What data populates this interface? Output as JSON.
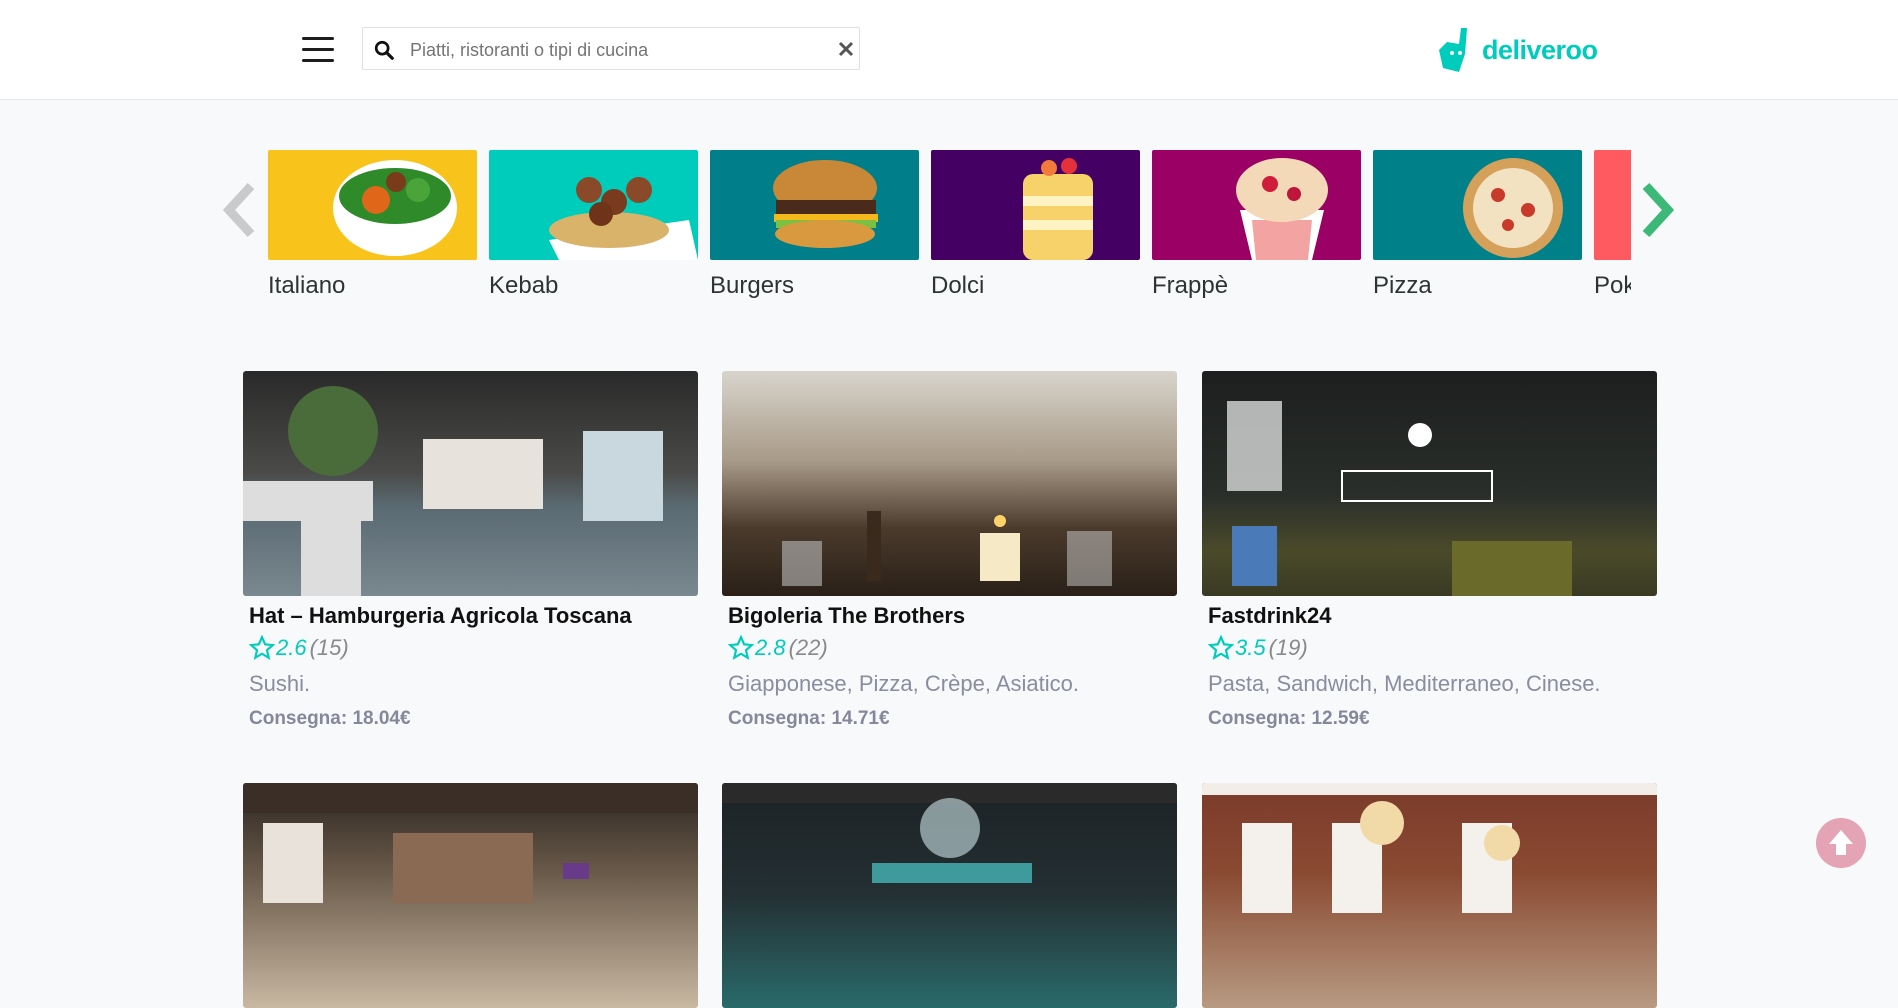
{
  "search": {
    "placeholder": "Piatti, ristoranti o tipi di cucina",
    "value": ""
  },
  "logo": {
    "text": "deliveroo"
  },
  "brand_color": "#00ccbc",
  "categories": [
    {
      "label": "Italiano",
      "bg": "#f8c31a"
    },
    {
      "label": "Kebab",
      "bg": "#00ccbc"
    },
    {
      "label": "Burgers",
      "bg": "#007e8a"
    },
    {
      "label": "Dolci",
      "bg": "#440063"
    },
    {
      "label": "Frappè",
      "bg": "#9b0064"
    },
    {
      "label": "Pizza",
      "bg": "#00818a"
    },
    {
      "label": "Poke",
      "bg": "#ff5a5f"
    }
  ],
  "restaurants": [
    {
      "name": "Hat – Hamburgeria Agricola Toscana",
      "rating": "2.6",
      "reviews": "(15)",
      "tags": "Sushi.",
      "delivery": "Consegna: 18.04€"
    },
    {
      "name": "Bigoleria The Brothers",
      "rating": "2.8",
      "reviews": "(22)",
      "tags": "Giapponese, Pizza, Crèpe, Asiatico.",
      "delivery": "Consegna: 14.71€"
    },
    {
      "name": "Fastdrink24",
      "rating": "3.5",
      "reviews": "(19)",
      "tags": "Pasta, Sandwich, Mediterraneo, Cinese.",
      "delivery": "Consegna: 12.59€"
    }
  ],
  "icons": {
    "menu": "hamburger-menu-icon",
    "search": "search-icon",
    "clear": "close-icon",
    "prev": "chevron-left-icon",
    "next": "chevron-right-icon",
    "star": "star-outline-icon",
    "scroll_top": "arrow-up-circle-icon"
  }
}
